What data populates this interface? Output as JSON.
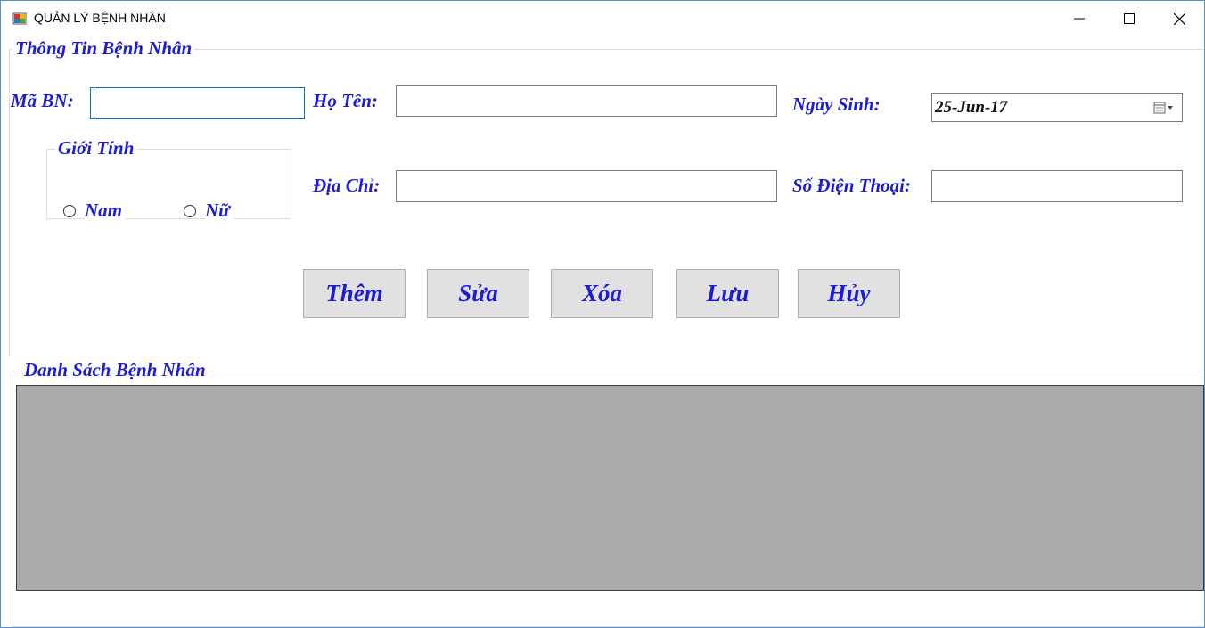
{
  "window": {
    "title": "QUẢN LÝ BỆNH NHÂN",
    "minimize_icon": "minimize-icon",
    "maximize_icon": "maximize-icon",
    "close_icon": "close-icon"
  },
  "info_group": {
    "legend": "Thông Tin Bệnh Nhân",
    "ma_bn_label": "Mã BN:",
    "ma_bn_value": "",
    "ho_ten_label": "Họ Tên:",
    "ho_ten_value": "",
    "ngay_sinh_label": "Ngày Sinh:",
    "ngay_sinh_value": "25-Jun-17",
    "dia_chi_label": "Địa Chỉ:",
    "dia_chi_value": "",
    "so_dien_thoai_label": "Số Điện Thoại:",
    "so_dien_thoai_value": ""
  },
  "gender_group": {
    "legend": "Giới Tính",
    "options": [
      "Nam",
      "Nữ"
    ],
    "selected": ""
  },
  "buttons": {
    "add": "Thêm",
    "edit": "Sửa",
    "delete": "Xóa",
    "save": "Lưu",
    "cancel": "Hủy"
  },
  "list_group": {
    "legend": "Danh Sách Bệnh Nhân"
  },
  "colors": {
    "label_blue": "#1c1cd6",
    "grid_background": "#ababab",
    "button_background": "#e1e1e1"
  }
}
